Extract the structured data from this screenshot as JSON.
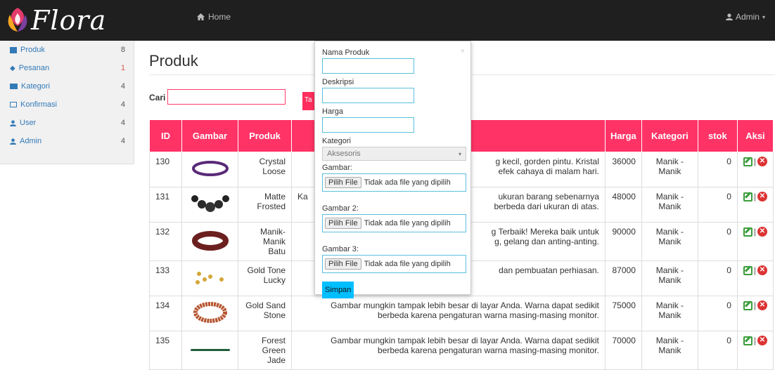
{
  "brand": {
    "name": "Flora"
  },
  "topnav": {
    "home": "Home",
    "admin": "Admin"
  },
  "sidebar": {
    "items": [
      {
        "label": "Produk",
        "count": "8"
      },
      {
        "label": "Pesanan",
        "count": "1"
      },
      {
        "label": "Kategori",
        "count": "4"
      },
      {
        "label": "Konfirmasi",
        "count": "4"
      },
      {
        "label": "User",
        "count": "4"
      },
      {
        "label": "Admin",
        "count": "4"
      }
    ]
  },
  "page": {
    "title": "Produk"
  },
  "search": {
    "label": "Cari",
    "value": "",
    "button": "Ta"
  },
  "table": {
    "headers": [
      "ID",
      "Gambar",
      "Produk",
      "",
      "Harga",
      "Kategori",
      "stok",
      "Aksi"
    ],
    "rows": [
      {
        "id": "130",
        "name_line1": "Crystal",
        "name_line2": "Loose",
        "desc_line1": "g kecil, gorden pintu. Kristal",
        "desc_line2": "efek cahaya di malam hari.",
        "price": "36000",
        "category": "Manik - Manik",
        "stok": "0"
      },
      {
        "id": "131",
        "name_line1": "Matte",
        "name_line2": "Frosted",
        "desc_line1": "ukuran barang sebenarnya",
        "desc_line2": "berbeda dari ukuran di atas.",
        "desc_prefix": "Ka",
        "price": "48000",
        "category": "Manik - Manik",
        "stok": "0"
      },
      {
        "id": "132",
        "name_line1": "Manik-",
        "name_line2": "Manik Batu",
        "desc_line1": "g Terbaik! Mereka baik untuk",
        "desc_line2": "g, gelang dan anting-anting.",
        "price": "90000",
        "category": "Manik - Manik",
        "stok": "0"
      },
      {
        "id": "133",
        "name_line1": "Gold Tone",
        "name_line2": "Lucky",
        "desc_line1": "dan pembuatan perhiasan.",
        "desc_line2": "",
        "price": "87000",
        "category": "Manik - Manik",
        "stok": "0"
      },
      {
        "id": "134",
        "name_line1": "Gold Sand",
        "name_line2": "Stone",
        "desc_line1": "Gambar mungkin tampak lebih besar di layar Anda. Warna dapat sedikit",
        "desc_line2": "berbeda karena pengaturan warna masing-masing monitor.",
        "price": "75000",
        "category": "Manik - Manik",
        "stok": "0"
      },
      {
        "id": "135",
        "name_line1": "Forest",
        "name_line2": "Green Jade",
        "desc_line1": "Gambar mungkin tampak lebih besar di layar Anda. Warna dapat sedikit",
        "desc_line2": "berbeda karena pengaturan warna masing-masing monitor.",
        "price": "70000",
        "category": "Manik - Manik",
        "stok": "0"
      }
    ],
    "aksi_separator": "|"
  },
  "modal": {
    "close": "×",
    "nama_label": "Nama Produk",
    "deskripsi_label": "Deskripsi",
    "harga_label": "Harga",
    "kategori_label": "Kategori",
    "kategori_value": "Aksesoris",
    "gambar1_label": "Gambar:",
    "gambar2_label": "Gambar 2:",
    "gambar3_label": "Gambar 3:",
    "file_button": "Pilih File",
    "file_none": "Tidak ada file yang dipilih",
    "save": "Simpan"
  },
  "colors": {
    "accent": "#ff3366",
    "topbar": "#1f1f1f",
    "link": "#337ab7",
    "modal_border": "#5bc0de",
    "save": "#00bfff"
  }
}
